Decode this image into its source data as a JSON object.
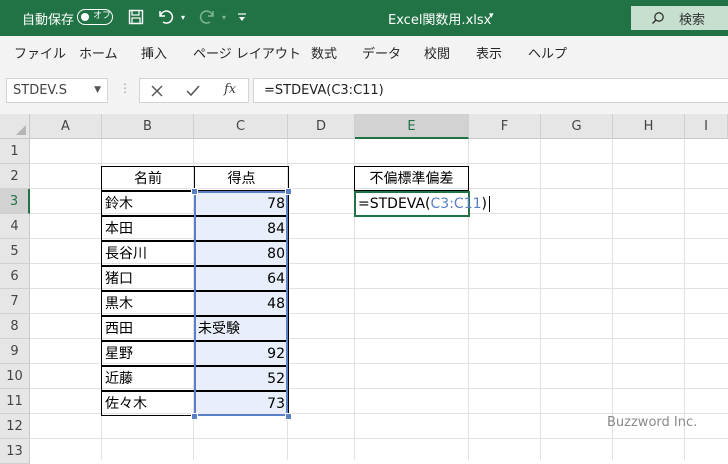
{
  "titlebar": {
    "autosave_label": "自動保存",
    "autosave_state": "オフ",
    "filename": "Excel関数用.xlsx",
    "search_label": "検索"
  },
  "menu": [
    "ファイル",
    "ホーム",
    "挿入",
    "ページ レイアウト",
    "数式",
    "データ",
    "校閲",
    "表示",
    "ヘルプ"
  ],
  "formula_bar": {
    "name_box": "STDEV.S",
    "fx_label": "fx",
    "formula": "=STDEVA(C3:C11)"
  },
  "columns": [
    "A",
    "B",
    "C",
    "D",
    "E",
    "F",
    "G",
    "H",
    "I"
  ],
  "rows": [
    "1",
    "2",
    "3",
    "4",
    "5",
    "6",
    "7",
    "8",
    "9",
    "10",
    "11",
    "12",
    "13"
  ],
  "table": {
    "header_name": "名前",
    "header_score": "得点",
    "rows": [
      {
        "name": "鈴木",
        "score": "78"
      },
      {
        "name": "本田",
        "score": "84"
      },
      {
        "name": "長谷川",
        "score": "80"
      },
      {
        "name": "猪口",
        "score": "64"
      },
      {
        "name": "黒木",
        "score": "48"
      },
      {
        "name": "西田",
        "score": "未受験"
      },
      {
        "name": "星野",
        "score": "92"
      },
      {
        "name": "近藤",
        "score": "52"
      },
      {
        "name": "佐々木",
        "score": "73"
      }
    ]
  },
  "result": {
    "header": "不偏標準偏差",
    "formula_prefix": "=STDEVA(",
    "formula_ref": "C3:C11",
    "formula_suffix": ")"
  },
  "watermark": "Buzzword Inc.",
  "colors": {
    "excel_green": "#217346",
    "range_blue": "#5b7fc7",
    "range_fill": "#e8effa"
  }
}
